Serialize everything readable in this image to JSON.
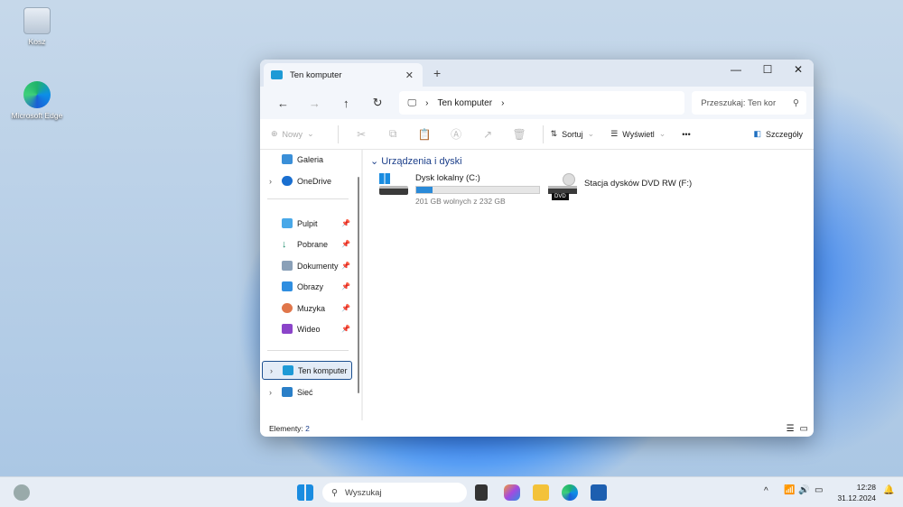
{
  "desktop": {
    "icons": [
      {
        "label": "Kosz"
      },
      {
        "label": "Microsoft Edge"
      }
    ]
  },
  "window": {
    "tab_title": "Ten komputer",
    "new_tab": "+",
    "minimize": "—",
    "maximize": "☐",
    "close": "✕",
    "address": {
      "crumb": "Ten komputer"
    },
    "search_placeholder": "Przeszukaj: Ten kor",
    "toolbar": {
      "new_label": "Nowy",
      "sort_label": "Sortuj",
      "view_label": "Wyświetl",
      "more": "•••",
      "details_label": "Szczegóły"
    },
    "sidebar": {
      "items": [
        {
          "label": "Galeria"
        },
        {
          "label": "OneDrive"
        },
        {
          "label": "Pulpit"
        },
        {
          "label": "Pobrane"
        },
        {
          "label": "Dokumenty"
        },
        {
          "label": "Obrazy"
        },
        {
          "label": "Muzyka"
        },
        {
          "label": "Wideo"
        },
        {
          "label": "Ten komputer"
        },
        {
          "label": "Sieć"
        }
      ]
    },
    "group_label": "Urządzenia i dyski",
    "drives": [
      {
        "name": "Dysk lokalny (C:)",
        "free_text": "201 GB wolnych z 232 GB",
        "used_fraction": 0.134
      },
      {
        "name": "Stacja dysków DVD RW (F:)",
        "badge": "DVD"
      }
    ],
    "status": {
      "label": "Elementy:",
      "count": "2"
    }
  },
  "taskbar": {
    "search_label": "Wyszukaj",
    "time": "12:28",
    "date": "31.12.2024"
  },
  "colors": {
    "accent": "#2a8ad8",
    "group": "#1c3f8a"
  }
}
